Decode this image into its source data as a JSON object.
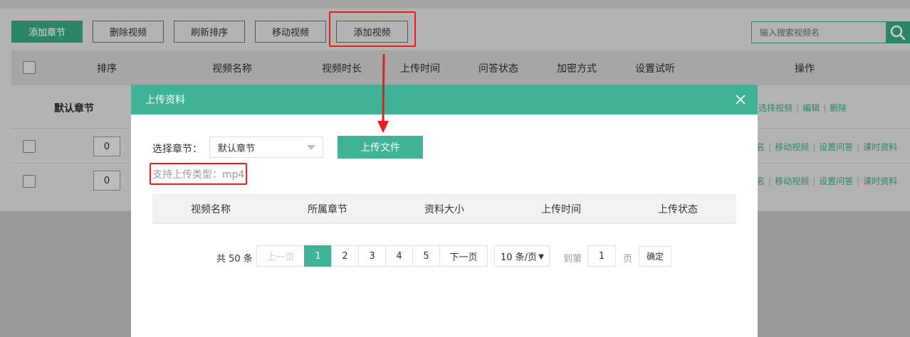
{
  "toolbar": {
    "add_chapter": "添加章节",
    "delete_video": "删除视频",
    "refresh_sort": "刷新排序",
    "move_video": "移动视频",
    "add_video": "添加视频"
  },
  "search": {
    "placeholder": "输入搜索视频名",
    "icon": "search-icon"
  },
  "table": {
    "columns": [
      "排序",
      "视频名称",
      "视频时长",
      "上传时间",
      "问答状态",
      "加密方式",
      "设置试听",
      "操作"
    ],
    "chapter_row": {
      "label": "默认章节",
      "ops": [
        "选择视频",
        "编辑",
        "删除"
      ]
    },
    "video_rows": [
      {
        "sort": "0",
        "ops": [
          "名",
          "移动视频",
          "设置问答",
          "课时资料"
        ]
      },
      {
        "sort": "0",
        "ops": [
          "名",
          "移动视频",
          "设置问答",
          "课时资料"
        ]
      }
    ]
  },
  "modal": {
    "title": "上传资料",
    "chapter_label": "选择章节：",
    "chapter_selected": "默认章节",
    "upload_button": "上传文件",
    "support_text": "支持上传类型：mp4",
    "columns": [
      "视频名称",
      "所属章节",
      "资料大小",
      "上传时间",
      "上传状态"
    ],
    "pager": {
      "total": "共 50 条",
      "prev": "上一页",
      "pages": [
        "1",
        "2",
        "3",
        "4",
        "5"
      ],
      "current": "1",
      "next": "下一页",
      "page_size": "10 条/页",
      "goto_prefix": "到第",
      "goto_value": "1",
      "goto_suffix": "页",
      "confirm": "确定"
    }
  },
  "colors": {
    "accent": "#40b295",
    "accent_dimmed": "#2c8569",
    "annotation": "#e81c1c"
  }
}
